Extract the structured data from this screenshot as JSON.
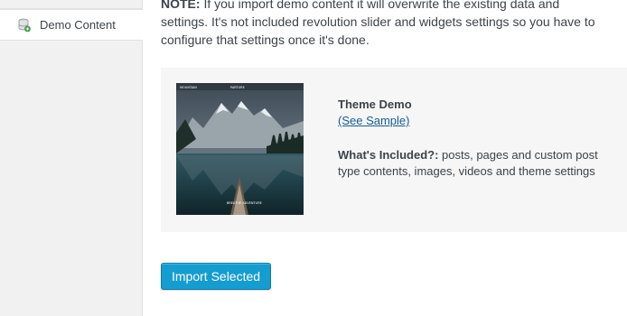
{
  "sidebar": {
    "item": {
      "label": "Demo Content",
      "icon": "database-icon"
    }
  },
  "notice": {
    "line1_prefix": "NOTE:",
    "line1_rest": " If you import demo content it will overwrite the existing data and",
    "line2": "settings. It's not included revolution slider and widgets settings so you have to",
    "line3": "configure that settings once it's done."
  },
  "demo": {
    "thumb_nav_brand": "MOUNTAIN",
    "thumb_nav_title": "PARTURE",
    "thumb_caption": "BREATHE ADVENTURE",
    "title": "Theme Demo",
    "sample_link": "(See Sample)",
    "included_label": "What's Included?:",
    "included_text": " posts, pages and custom post type contents, images, videos and theme settings"
  },
  "actions": {
    "import_label": "Import Selected"
  },
  "colors": {
    "primary": "#149dd0",
    "link": "#135e96",
    "panel": "#f6f6f6",
    "sidebar": "#f1f1f1"
  }
}
